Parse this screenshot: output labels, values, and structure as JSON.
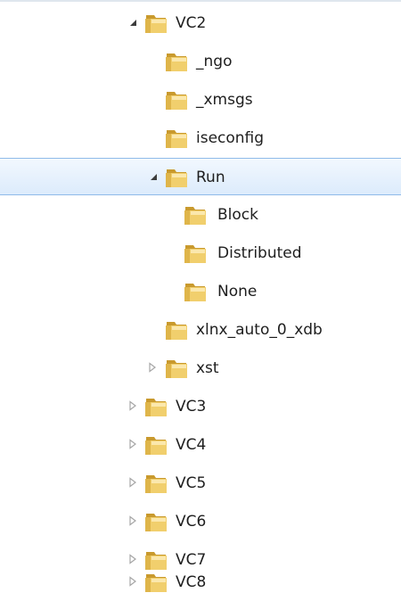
{
  "tree": {
    "items": [
      {
        "label": "VC2",
        "state": "expanded"
      },
      {
        "label": "_ngo",
        "state": "leaf"
      },
      {
        "label": "_xmsgs",
        "state": "leaf"
      },
      {
        "label": "iseconfig",
        "state": "leaf"
      },
      {
        "label": "Run",
        "state": "expanded",
        "selected": true
      },
      {
        "label": "Block",
        "state": "leaf"
      },
      {
        "label": "Distributed",
        "state": "leaf"
      },
      {
        "label": "None",
        "state": "leaf"
      },
      {
        "label": "xlnx_auto_0_xdb",
        "state": "leaf"
      },
      {
        "label": "xst",
        "state": "collapsed"
      },
      {
        "label": "VC3",
        "state": "collapsed"
      },
      {
        "label": "VC4",
        "state": "collapsed"
      },
      {
        "label": "VC5",
        "state": "collapsed"
      },
      {
        "label": "VC6",
        "state": "collapsed"
      },
      {
        "label": "VC7",
        "state": "collapsed"
      },
      {
        "label": "VC8",
        "state": "collapsed"
      }
    ]
  },
  "colors": {
    "selection_border": "#8fbbe9",
    "selection_fill": "#dcebfc",
    "folder": "#e8c25a",
    "expanded_arrow": "#3c3c3c",
    "collapsed_arrow": "#a6a6a6"
  }
}
